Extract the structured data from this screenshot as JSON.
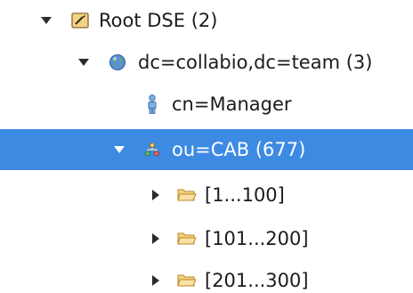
{
  "tree": {
    "nodes": [
      {
        "label": "Root DSE (2)",
        "icon": "root-dse-icon",
        "twisty": "expanded",
        "selected": false
      },
      {
        "label": "dc=collabio,dc=team (3)",
        "icon": "globe-icon",
        "twisty": "expanded",
        "selected": false
      },
      {
        "label": "cn=Manager",
        "icon": "person-icon",
        "twisty": "none",
        "selected": false
      },
      {
        "label": "ou=CAB (677)",
        "icon": "org-unit-icon",
        "twisty": "expanded",
        "selected": true
      },
      {
        "label": "[1...100]",
        "icon": "folder-icon",
        "twisty": "collapsed",
        "selected": false
      },
      {
        "label": "[101...200]",
        "icon": "folder-icon",
        "twisty": "collapsed",
        "selected": false
      },
      {
        "label": "[201...300]",
        "icon": "folder-icon",
        "twisty": "collapsed",
        "selected": false
      }
    ]
  },
  "colors": {
    "selection": "#3d8ae2",
    "text": "#1c1c1c",
    "selected_text": "#ffffff",
    "folder": "#e9b34a"
  }
}
